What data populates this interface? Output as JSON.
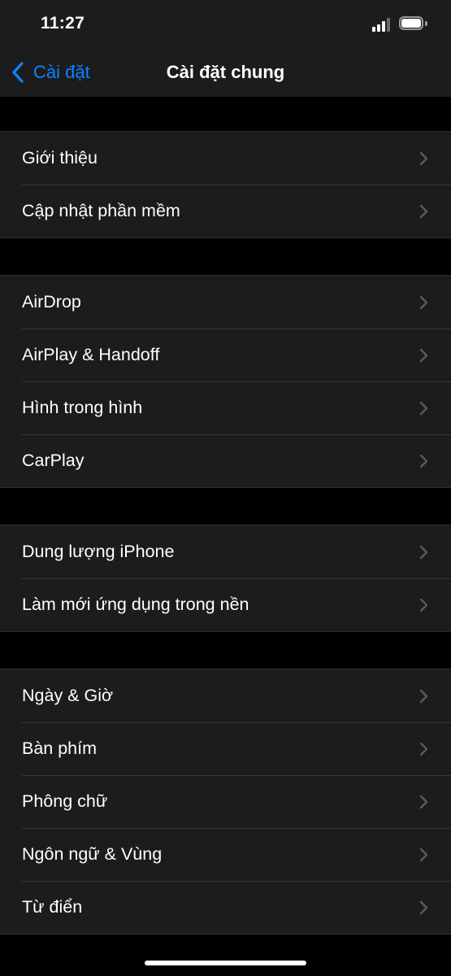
{
  "status_bar": {
    "time": "11:27",
    "signal_icon": "cellular-signal-icon",
    "battery_icon": "battery-icon"
  },
  "nav": {
    "back_label": "Cài đặt",
    "back_icon": "chevron-left-icon",
    "title": "Cài đặt chung"
  },
  "colors": {
    "accent": "#0a84ff",
    "background": "#000000",
    "cell_background": "#1c1c1e",
    "separator": "#38383a",
    "chevron": "#5a5a5e"
  },
  "groups": [
    {
      "items": [
        {
          "label": "Giới thiệu"
        },
        {
          "label": "Cập nhật phần mềm"
        }
      ]
    },
    {
      "items": [
        {
          "label": "AirDrop"
        },
        {
          "label": "AirPlay & Handoff"
        },
        {
          "label": "Hình trong hình"
        },
        {
          "label": "CarPlay"
        }
      ]
    },
    {
      "items": [
        {
          "label": "Dung lượng iPhone"
        },
        {
          "label": "Làm mới ứng dụng trong nền"
        }
      ]
    },
    {
      "items": [
        {
          "label": "Ngày & Giờ"
        },
        {
          "label": "Bàn phím"
        },
        {
          "label": "Phông chữ"
        },
        {
          "label": "Ngôn ngữ & Vùng"
        },
        {
          "label": "Từ điển"
        }
      ]
    }
  ]
}
